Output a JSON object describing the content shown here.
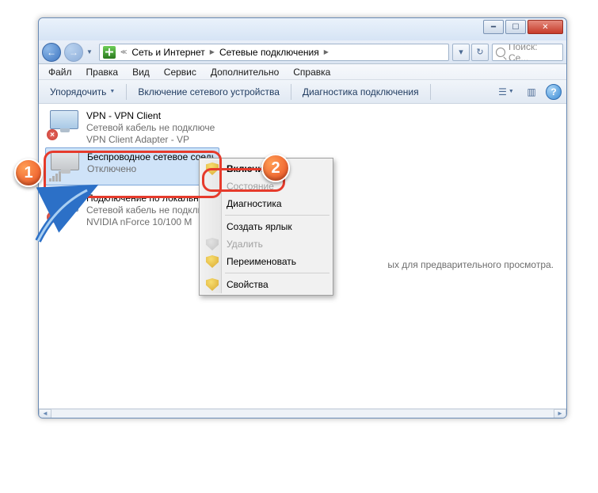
{
  "breadcrumb": {
    "level1": "Сеть и Интернет",
    "level2": "Сетевые подключения"
  },
  "search": {
    "placeholder": "Поиск: Се..."
  },
  "menubar": {
    "file": "Файл",
    "edit": "Правка",
    "view": "Вид",
    "tools": "Сервис",
    "extra": "Дополнительно",
    "help": "Справка"
  },
  "toolbar": {
    "organize": "Упорядочить",
    "enable_device": "Включение сетевого устройства",
    "diagnose": "Диагностика подключения"
  },
  "connections": [
    {
      "name": "VPN - VPN Client",
      "status": "Сетевой кабель не подключен",
      "adapter": "VPN Client Adapter - VP"
    },
    {
      "name": "Беспроводное сетевое соединение",
      "status": "Отключено",
      "adapter": ""
    },
    {
      "name": "Подключение по локальной сети",
      "status": "Сетевой кабель не подключен",
      "adapter": "NVIDIA nForce 10/100 M"
    }
  ],
  "context_menu": {
    "enable": "Включить",
    "status": "Состояние",
    "diagnose": "Диагностика",
    "create_shortcut": "Создать ярлык",
    "delete": "Удалить",
    "rename": "Переименовать",
    "properties": "Свойства"
  },
  "preview_hint": "ых для предварительного просмотра.",
  "callouts": {
    "one": "1",
    "two": "2"
  }
}
